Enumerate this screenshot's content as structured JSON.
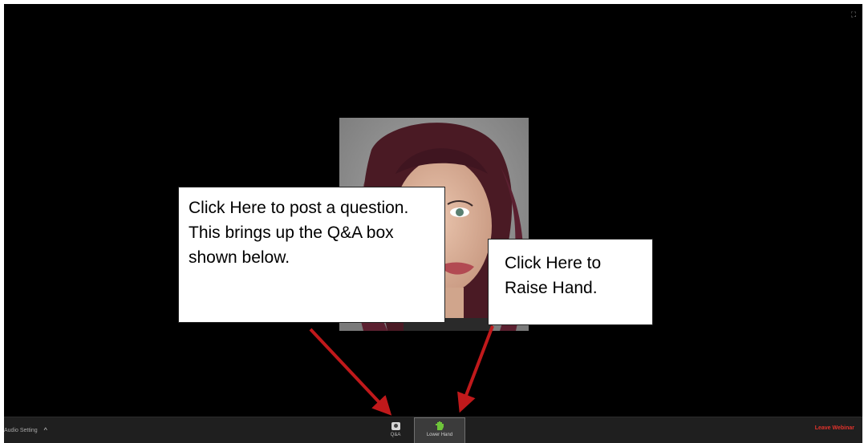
{
  "toolbar": {
    "audio_setting_label": "Audio Setting",
    "audio_caret": "^",
    "qa_label": "Q&A",
    "lower_hand_label": "Lower Hand",
    "leave_label": "Leave Webinar"
  },
  "annotations": {
    "qa_callout": "Click Here to post a question. This brings up the Q&A box shown below.",
    "raise_hand_callout": "Click Here to Raise Hand."
  },
  "colors": {
    "window_bg": "#000000",
    "toolbar_bg": "#1f1f1f",
    "leave_text": "#e0322b",
    "arrow": "#c0191b",
    "hand_icon": "#6ec43a"
  },
  "icons": {
    "fullscreen": "fullscreen-icon",
    "qa": "qa-icon",
    "hand": "hand-icon",
    "caret": "chevron-up-icon"
  }
}
